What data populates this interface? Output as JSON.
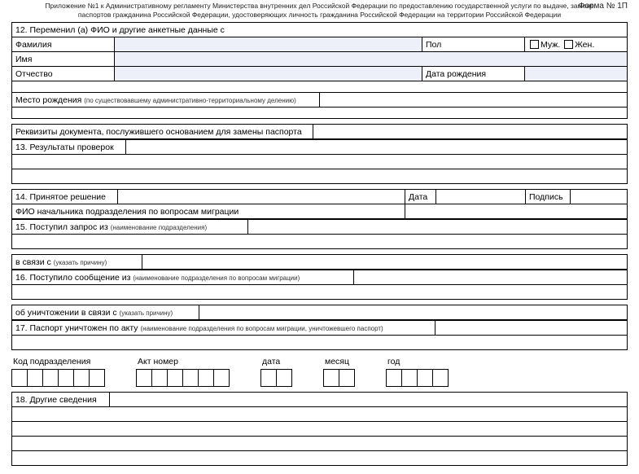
{
  "header": {
    "line1": "Приложение №1 к Административному регламенту Министерства внутренних дел Российской Федерации по предоставлению государственной услуги по выдаче, замене",
    "line2": "паспортов гражданина Российской Федерации, удостоверяющих личность гражданина Российской Федерации на территории Российской Федерации",
    "form_no": "Форма № 1П"
  },
  "s12": {
    "title": "12. Переменил (а) ФИО и другие анкетные данные с",
    "surname": "Фамилия",
    "name": "Имя",
    "patronymic": "Отчество",
    "gender": "Пол",
    "male": "Муж.",
    "female": "Жен.",
    "birth_date": "Дата рождения",
    "birth_place": "Место рождения",
    "birth_place_note": "(по существовавшему административно-территориальному делению)"
  },
  "doc_reason": "Реквизиты документа, послужившего основанием для замены паспорта",
  "s13": "13. Результаты проверок",
  "s14": {
    "title": "14. Принятое решение",
    "date": "Дата",
    "sign": "Подпись",
    "chief": "ФИО начальника подразделения по вопросам миграции"
  },
  "s15": {
    "title": "15. Поступил запрос из",
    "note": "(наименование подразделения)",
    "reason": "в связи с",
    "reason_note": "(указать причину)"
  },
  "s16": {
    "title": "16. Поступило сообщение из",
    "note": "(наименование подразделения по вопросам миграции)",
    "destroy": "об уничтожении в связи с",
    "destroy_note": "(указать причину)"
  },
  "s17": {
    "title": "17. Паспорт уничтожен по акту",
    "note": "(наименование подразделения по вопросам миграции, уничтожевшего паспорт)"
  },
  "code_boxes": {
    "code": "Код подразделения",
    "act": "Акт номер",
    "date": "дата",
    "month": "месяц",
    "year": "год"
  },
  "s18": "18. Другие сведения"
}
